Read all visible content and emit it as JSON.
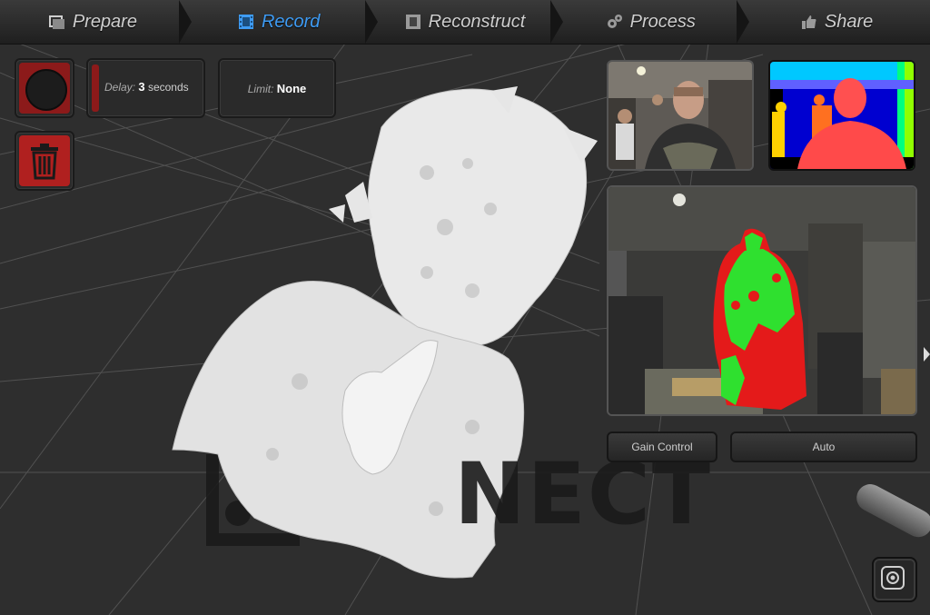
{
  "app": {
    "nav": [
      {
        "label": "Prepare",
        "icon": "photos-icon",
        "active": false
      },
      {
        "label": "Record",
        "icon": "film-icon",
        "active": true
      },
      {
        "label": "Reconstruct",
        "icon": "film-icon",
        "active": false
      },
      {
        "label": "Process",
        "icon": "gears-icon",
        "active": false
      },
      {
        "label": "Share",
        "icon": "thumbs-up-icon",
        "active": false
      }
    ]
  },
  "controls": {
    "delay": {
      "label": "Delay:",
      "value": "3",
      "unit": "seconds"
    },
    "limit": {
      "label": "Limit:",
      "value": "None"
    }
  },
  "camera": {
    "gain_label": "Gain Control",
    "gain_value": "Auto"
  },
  "brand": {
    "watermark": "NECT"
  },
  "colors": {
    "accent": "#3e9bf3",
    "record_red": "#8c1a1a",
    "delete_red": "#b0201f",
    "depth_red": "#e02020",
    "depth_green": "#2fe02f"
  }
}
